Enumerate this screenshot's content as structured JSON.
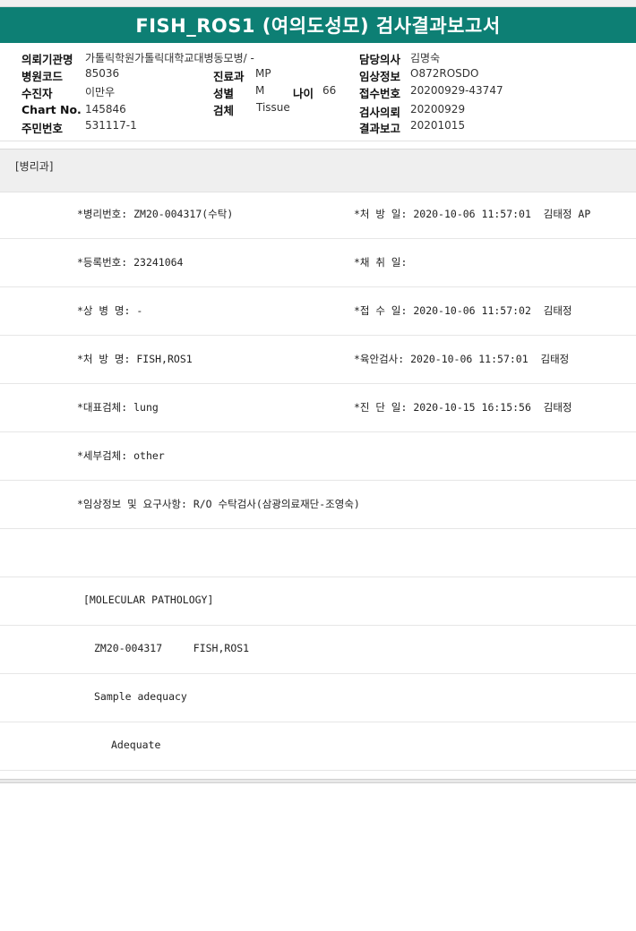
{
  "title": "FISH_ROS1 (여의도성모) 검사결과보고서",
  "info": {
    "hospital_label": "의뢰기관명",
    "hospital_value": "가톨릭학원가톨릭대학교대병동모병/ -",
    "doctor_label": "담당의사",
    "doctor_value": "김명숙",
    "code_label": "병원코드",
    "code_value": "85036",
    "dept_label": "진료과",
    "dept_value": "MP",
    "clinical_label": "임상정보",
    "clinical_value": "O872ROSDO",
    "patient_label": "수진자",
    "patient_value": "이만우",
    "sex_label": "성별",
    "sex_value": "M",
    "age_label": "나이",
    "age_value": "66",
    "receipt_label": "접수번호",
    "receipt_value": "20200929-43747",
    "chart_label": "Chart No.",
    "chart_value": "145846",
    "specimen_label": "검체",
    "specimen_value": "Tissue",
    "request_label": "검사의뢰",
    "request_value": "20200929",
    "id_label": "주민번호",
    "id_value": "531117-1",
    "report_label": "결과보고",
    "report_value": "20201015"
  },
  "dept_section": "[병리과]",
  "rows": [
    {
      "left": "*병리번호: ZM20-004317(수탁)",
      "right": "*처 방 일: 2020-10-06 11:57:01  김태정 AP"
    },
    {
      "left": "*등록번호: 23241064",
      "right": "*채 취 일:"
    },
    {
      "left": "*상 병 명: -",
      "right": "*접 수 일: 2020-10-06 11:57:02  김태정"
    },
    {
      "left": "*처 방 명: FISH,ROS1",
      "right": "*육안검사: 2020-10-06 11:57:01  김태정"
    },
    {
      "left": "*대표검체: lung",
      "right": "*진 단 일: 2020-10-15 16:15:56  김태정"
    },
    {
      "left": "*세부검체: other",
      "right": ""
    },
    {
      "left": "*임상정보 및 요구사항: R/O 수탁검사(삼광의료재단-조영숙)",
      "right": ""
    },
    {
      "left": "",
      "right": ""
    },
    {
      "left": "[MOLECULAR PATHOLOGY]",
      "right": ""
    },
    {
      "left": "ZM20-004317     FISH,ROS1",
      "right": ""
    },
    {
      "left": "Sample adequacy",
      "right": ""
    },
    {
      "left": "Adequate",
      "right": ""
    }
  ]
}
